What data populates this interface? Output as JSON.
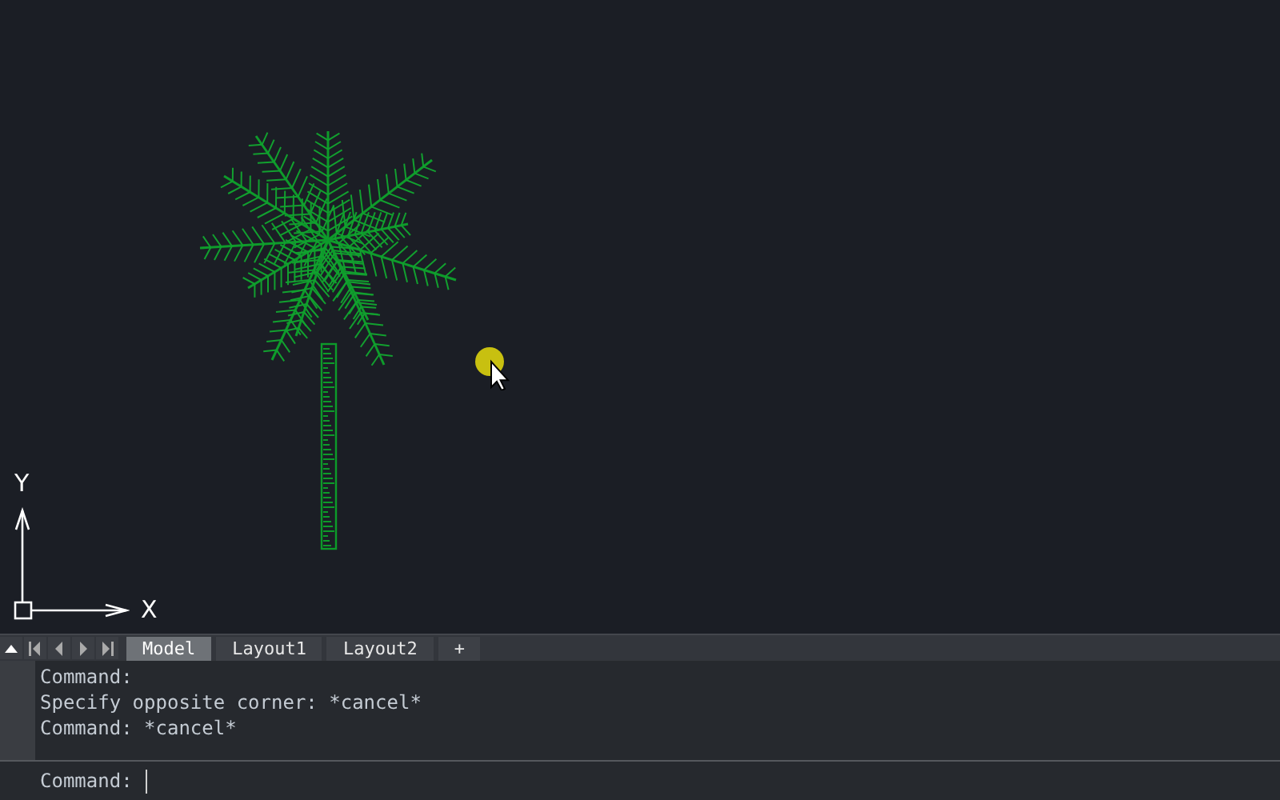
{
  "canvas": {
    "ucs": {
      "x_label": "X",
      "y_label": "Y"
    }
  },
  "tabs": [
    {
      "label": "Model",
      "selected": true
    },
    {
      "label": "Layout1",
      "selected": false
    },
    {
      "label": "Layout2",
      "selected": false
    },
    {
      "label": "+",
      "selected": false
    }
  ],
  "command_history": [
    "Command:",
    "Specify opposite corner: *cancel*",
    "Command: *cancel*"
  ],
  "command_line": {
    "prompt": "Command:"
  }
}
